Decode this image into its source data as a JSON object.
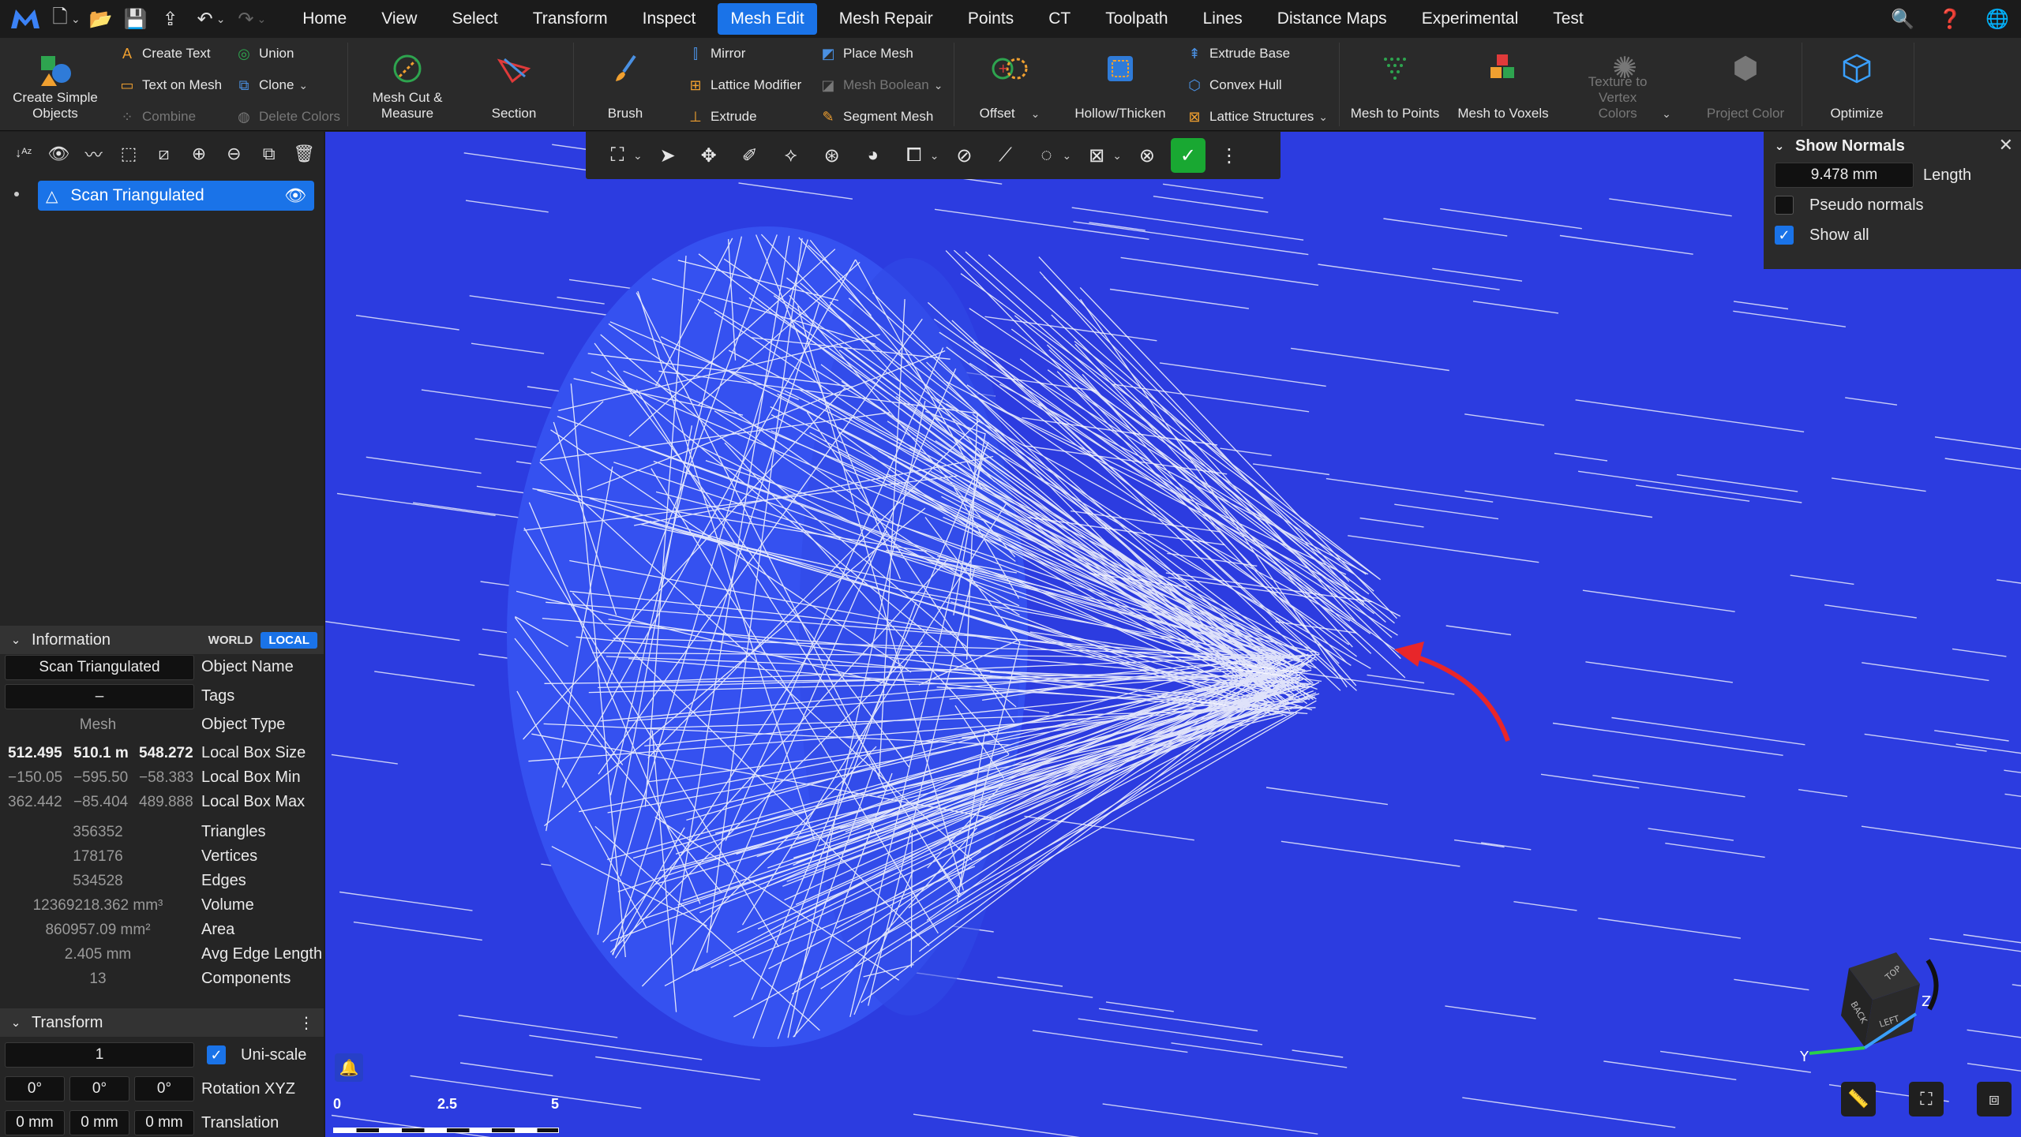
{
  "menubar": {
    "tabs": [
      "Home",
      "View",
      "Select",
      "Transform",
      "Inspect",
      "Mesh Edit",
      "Mesh Repair",
      "Points",
      "CT",
      "Toolpath",
      "Lines",
      "Distance Maps",
      "Experimental",
      "Test"
    ],
    "active_tab": "Mesh Edit"
  },
  "ribbon": {
    "create_simple_objects": "Create Simple Objects",
    "create_text": "Create Text",
    "text_on_mesh": "Text on Mesh",
    "combine": "Combine",
    "union": "Union",
    "clone": "Clone",
    "delete_colors": "Delete Colors",
    "mesh_cut_measure": "Mesh Cut & Measure",
    "section": "Section",
    "brush": "Brush",
    "mirror": "Mirror",
    "lattice_modifier": "Lattice Modifier",
    "extrude": "Extrude",
    "place_mesh": "Place Mesh",
    "mesh_boolean": "Mesh Boolean",
    "segment_mesh": "Segment Mesh",
    "offset": "Offset",
    "hollow_thicken": "Hollow/Thicken",
    "extrude_base": "Extrude Base",
    "convex_hull": "Convex Hull",
    "lattice_structures": "Lattice Structures",
    "mesh_to_points": "Mesh to Points",
    "mesh_to_voxels": "Mesh to Voxels",
    "texture_to_vertex_colors": "Texture to Vertex Colors",
    "project_color": "Project Color",
    "optimize": "Optimize"
  },
  "scene": {
    "item_label": "Scan Triangulated"
  },
  "information": {
    "title": "Information",
    "world": "WORLD",
    "local": "LOCAL",
    "object_name": {
      "value": "Scan Triangulated",
      "label": "Object Name"
    },
    "tags": {
      "value": "–",
      "label": "Tags"
    },
    "object_type": {
      "value": "Mesh",
      "label": "Object Type"
    },
    "local_box_size": {
      "values": [
        "512.495",
        "510.1 m",
        "548.272"
      ],
      "label": "Local Box Size"
    },
    "local_box_min": {
      "values": [
        "−150.05",
        "−595.50",
        "−58.383"
      ],
      "label": "Local Box Min"
    },
    "local_box_max": {
      "values": [
        "362.442",
        "−85.404",
        "489.888"
      ],
      "label": "Local Box Max"
    },
    "triangles": {
      "value": "356352",
      "label": "Triangles"
    },
    "vertices": {
      "value": "178176",
      "label": "Vertices"
    },
    "edges": {
      "value": "534528",
      "label": "Edges"
    },
    "volume": {
      "value": "12369218.362 mm³",
      "label": "Volume"
    },
    "area": {
      "value": "860957.09 mm²",
      "label": "Area"
    },
    "avg_edge_length": {
      "value": "2.405 mm",
      "label": "Avg Edge Length"
    },
    "components": {
      "value": "13",
      "label": "Components"
    }
  },
  "transform": {
    "title": "Transform",
    "scale_value": "1",
    "uniscale_label": "Uni-scale",
    "uniscale_checked": true,
    "rotation": [
      "0°",
      "0°",
      "0°"
    ],
    "rotation_label": "Rotation XYZ",
    "translation": [
      "0 mm",
      "0 mm",
      "0 mm"
    ],
    "translation_label": "Translation"
  },
  "show_normals": {
    "title": "Show Normals",
    "length_value": "9.478 mm",
    "length_label": "Length",
    "pseudo_normals_label": "Pseudo normals",
    "pseudo_normals_checked": false,
    "show_all_label": "Show all",
    "show_all_checked": true
  },
  "scalebar": {
    "labels": [
      "0",
      "2.5",
      "5"
    ]
  },
  "viewcube": {
    "faces": [
      "TOP",
      "LEFT",
      "BACK"
    ],
    "axes": [
      "Z",
      "Y"
    ]
  },
  "colors": {
    "accent": "#1a73e8",
    "viewport_bg": "#2c3ce0",
    "mesh": "#3551f0",
    "normals": "#ffffff",
    "annotation_arrow": "#e8262a",
    "confirm": "#19a832"
  }
}
